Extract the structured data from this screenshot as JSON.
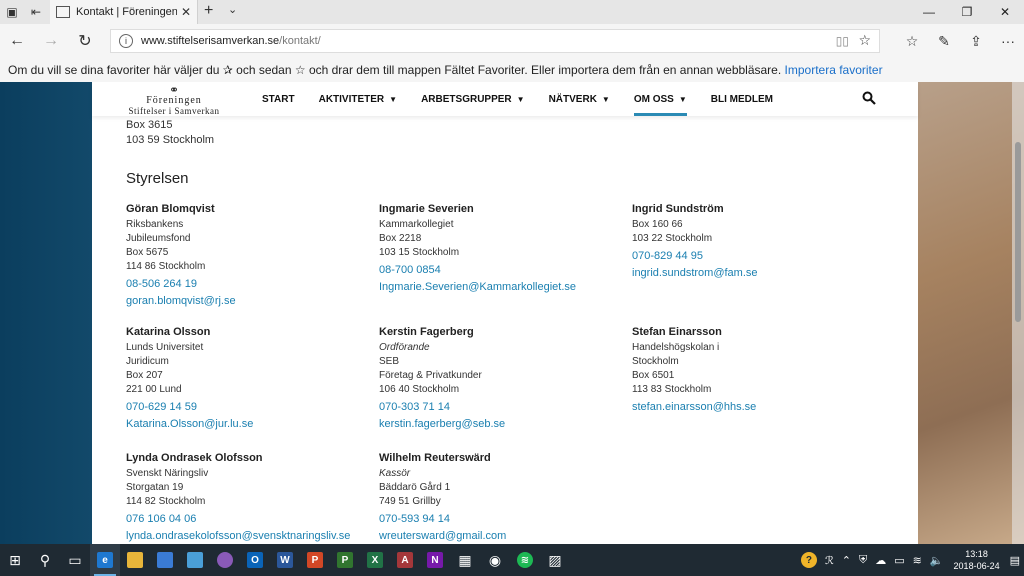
{
  "browser": {
    "tab_title": "Kontakt | Föreningen St",
    "url_host": "www.stiftelserisamverkan.se",
    "url_path": "/kontakt/",
    "favorites_text": "Om du vill se dina favoriter här väljer du  ✰  och sedan ☆ och drar dem till mappen Fältet Favoriter. Eller importera dem från en annan webbläsare.",
    "import_link": "Importera favoriter"
  },
  "site": {
    "logo_line1": "Föreningen",
    "logo_line2": "Stiftelser i Samverkan",
    "menu": [
      {
        "label": "START",
        "dropdown": false
      },
      {
        "label": "AKTIVITETER",
        "dropdown": true
      },
      {
        "label": "ARBETSGRUPPER",
        "dropdown": true
      },
      {
        "label": "NÄTVERK",
        "dropdown": true
      },
      {
        "label": "OM OSS",
        "dropdown": true,
        "active": true
      },
      {
        "label": "BLI MEDLEM",
        "dropdown": false
      }
    ]
  },
  "address": {
    "line1": "Box 3615",
    "line2": "103 59 Stockholm"
  },
  "section_title": "Styrelsen",
  "board": [
    {
      "name": "Göran Blomqvist",
      "lines": [
        "Riksbankens",
        "Jubileumsfond",
        "Box 5675",
        "114 86 Stockholm"
      ],
      "phone": "08-506 264 19",
      "email": "goran.blomqvist@rj.se"
    },
    {
      "name": "Ingmarie Severien",
      "lines": [
        "Kammarkollegiet",
        "Box 2218",
        "103 15 Stockholm"
      ],
      "phone": "08-700 0854",
      "email": "Ingmarie.Severien@Kammarkollegiet.se"
    },
    {
      "name": "Ingrid Sundström",
      "lines": [
        "Box 160 66",
        "103 22 Stockholm"
      ],
      "phone": "070-829 44 95",
      "email": "ingrid.sundstrom@fam.se"
    },
    {
      "name": "Katarina Olsson",
      "lines": [
        "Lunds Universitet",
        "Juridicum",
        "Box 207",
        "221 00 Lund"
      ],
      "phone": "070-629 14 59",
      "email": "Katarina.Olsson@jur.lu.se"
    },
    {
      "name": "Kerstin Fagerberg",
      "role": "Ordförande",
      "lines": [
        "SEB",
        "Företag & Privatkunder",
        "106 40 Stockholm"
      ],
      "phone": "070-303 71 14",
      "email": "kerstin.fagerberg@seb.se"
    },
    {
      "name": "Stefan Einarsson",
      "lines": [
        "Handelshögskolan i",
        "Stockholm",
        "Box 6501",
        "113 83 Stockholm"
      ],
      "email": "stefan.einarsson@hhs.se"
    },
    {
      "name": "Lynda Ondrasek Olofsson",
      "lines": [
        "Svenskt Näringsliv",
        "Storgatan 19",
        "114 82 Stockholm"
      ],
      "phone": "076 106 04 06",
      "email": "lynda.ondrasekolofsson@svensktnaringsliv.se"
    },
    {
      "name": "Wilhelm Reuterswärd",
      "role": "Kassör",
      "lines": [
        "Bäddarö Gård 1",
        "749 51 Grillby"
      ],
      "phone": "070-593 94 14",
      "email": "wreutersward@gmail.com"
    }
  ],
  "taskbar": {
    "time": "13:18",
    "date": "2018-06-24"
  }
}
